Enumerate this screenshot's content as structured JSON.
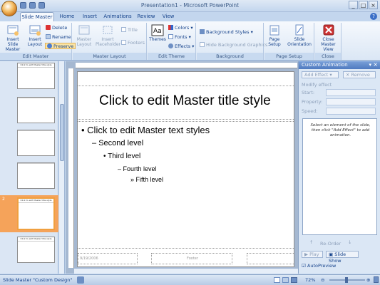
{
  "window": {
    "title": "Presentation1 - Microsoft PowerPoint"
  },
  "tabs": [
    "Slide Master",
    "Home",
    "Insert",
    "Animations",
    "Review",
    "View"
  ],
  "ribbon": {
    "edit_master": {
      "label": "Edit Master",
      "insert_slide_master": "Insert Slide Master",
      "insert_layout": "Insert Layout",
      "delete": "Delete",
      "rename": "Rename",
      "preserve": "Preserve"
    },
    "master_layout": {
      "label": "Master Layout",
      "master_layout": "Master Layout",
      "insert_placeholder": "Insert Placeholder",
      "title": "Title",
      "footers": "Footers"
    },
    "edit_theme": {
      "label": "Edit Theme",
      "themes": "Themes",
      "colors": "Colors",
      "fonts": "Fonts",
      "effects": "Effects"
    },
    "background": {
      "label": "Background",
      "background_styles": "Background Styles",
      "hide_background_graphics": "Hide Background Graphics"
    },
    "page_setup": {
      "label": "Page Setup",
      "page_setup": "Page Setup",
      "slide_orientation": "Slide Orientation"
    },
    "close": {
      "label": "Close",
      "close_master_view": "Close Master View"
    }
  },
  "slide": {
    "title": "Click to edit Master title style",
    "level1": "Click to edit Master text styles",
    "level2": "Second level",
    "level3": "Third level",
    "level4": "Fourth level",
    "level5": "Fifth level",
    "footer_date": "9/19/2006",
    "footer_text": "Footer"
  },
  "thumbs": {
    "title_text": "Click to edit Master title style",
    "selected_number": "2"
  },
  "task_pane": {
    "title": "Custom Animation",
    "add_effect": "Add Effect",
    "remove": "Remove",
    "modify_effect": "Modify effect",
    "start": "Start:",
    "property": "Property:",
    "speed": "Speed:",
    "hint": "Select an element of the slide, then click \"Add Effect\" to add animation.",
    "reorder": "Re-Order",
    "play": "Play",
    "slide_show": "Slide Show",
    "autopreview": "AutoPreview"
  },
  "status": {
    "view": "Slide Master",
    "theme": "\"Custom Design\"",
    "zoom": "72%"
  },
  "colors": {
    "accent": "#15428b",
    "selection": "#f5a35a",
    "close_icon": "#cc3333"
  }
}
